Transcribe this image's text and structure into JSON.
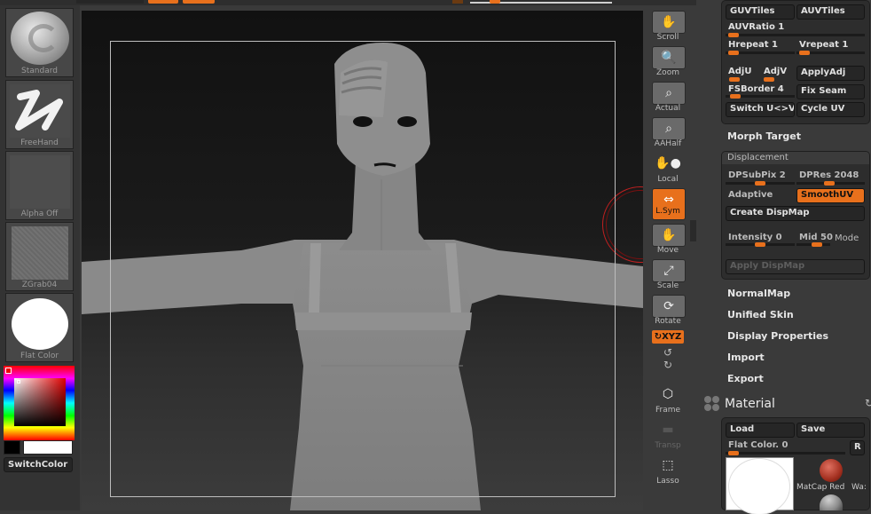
{
  "left_shelf": {
    "brush": {
      "label": "Standard"
    },
    "stroke": {
      "label": "FreeHand"
    },
    "alpha": {
      "label": "Alpha  Off"
    },
    "texture": {
      "label": "ZGrab04"
    },
    "material": {
      "label": "Flat  Color"
    },
    "color_picker": {
      "main_color": "#ffffff",
      "secondary_color": "#000000"
    },
    "switch_color_label": "SwitchColor"
  },
  "right_toolbar": {
    "buttons": [
      {
        "label": "Scroll",
        "icon": "scroll-icon"
      },
      {
        "label": "Zoom",
        "icon": "zoom-icon"
      },
      {
        "label": "Actual",
        "icon": "actual-icon"
      },
      {
        "label": "AAHalf",
        "icon": "aahalf-icon"
      },
      {
        "label": "Local",
        "icon": "local-icon"
      },
      {
        "label": "L.Sym",
        "icon": "lsym-icon",
        "active": true
      },
      {
        "label": "Move",
        "icon": "move-icon"
      },
      {
        "label": "Scale",
        "icon": "scale-icon"
      },
      {
        "label": "Rotate",
        "icon": "rotate-icon"
      },
      {
        "label": "XYZ",
        "icon": "xyz-icon",
        "active": true
      },
      {
        "label": "Frame",
        "icon": "frame-icon"
      },
      {
        "label": "Transp",
        "icon": "transp-icon",
        "disabled": true
      },
      {
        "label": "Lasso",
        "icon": "lasso-icon"
      }
    ]
  },
  "uv_panel": {
    "guv_tiles": "GUVTiles",
    "auv_tiles": "AUVTiles",
    "auv_ratio": "AUVRatio 1",
    "hrepeat": "Hrepeat 1",
    "vrepeat": "Vrepeat 1",
    "adj_u": "AdjU",
    "adj_v": "AdjV",
    "apply_adj": "ApplyAdj",
    "fs_border": "FSBorder 4",
    "fix_seam": "Fix Seam",
    "switch_uv": "Switch U<>V",
    "cycle_uv": "Cycle UV"
  },
  "morph_target": "Morph Target",
  "displacement": {
    "title": "Displacement",
    "dp_subpix": "DPSubPix 2",
    "dp_res": "DPRes 2048",
    "adaptive": "Adaptive",
    "smooth_uv": "SmoothUV",
    "create_dispmap": "Create DispMap",
    "intensity": "Intensity 0",
    "mid": "Mid 50",
    "mode": "Mode",
    "apply_dispmap": "Apply DispMap"
  },
  "tool_menu": [
    "NormalMap",
    "Unified Skin",
    "Display Properties",
    "Import",
    "Export"
  ],
  "material_palette": {
    "title": "Material",
    "load": "Load",
    "save": "Save",
    "flat_color": "Flat Color. 0",
    "r_button": "R",
    "thumbs": [
      "MatCap Red",
      "Wa:"
    ]
  }
}
